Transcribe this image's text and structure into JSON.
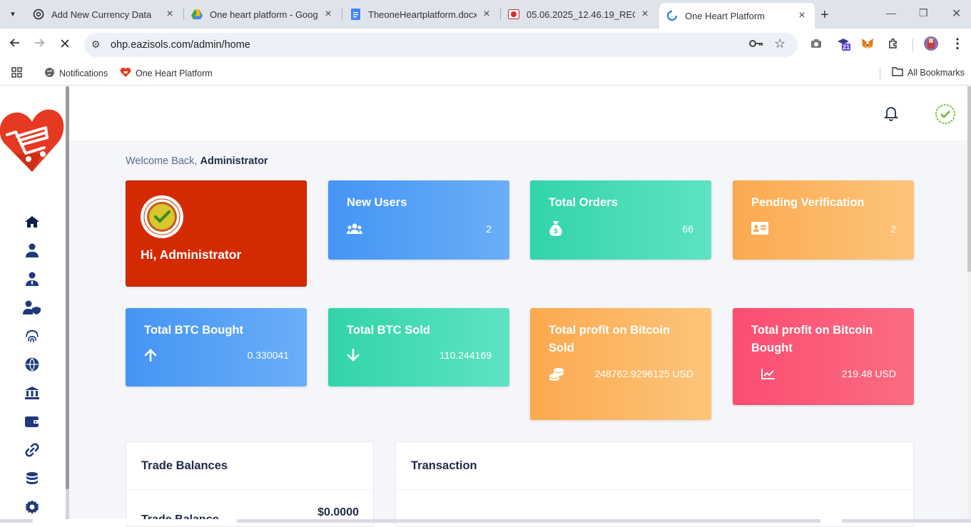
{
  "browser": {
    "tabs": [
      {
        "title": "Add New Currency Data",
        "icon": "openai-icon"
      },
      {
        "title": "One heart platform - Google",
        "icon": "google-drive-icon"
      },
      {
        "title": "TheoneHeartplatform.docx -",
        "icon": "docs-icon"
      },
      {
        "title": "05.06.2025_12.46.19_REC",
        "icon": "recording-icon"
      },
      {
        "title": "One Heart Platform",
        "icon": "loading-spinner-icon"
      }
    ],
    "url": "ohp.eazisols.com/admin/home",
    "extension_badge": "21",
    "bookmarks": [
      {
        "label": "Notifications"
      },
      {
        "label": "One Heart Platform"
      }
    ],
    "all_bookmarks_label": "All Bookmarks"
  },
  "welcome": {
    "prefix": "Welcome Back,",
    "name": "Administrator"
  },
  "hi_card": {
    "text": "Hi, Administrator"
  },
  "stats": [
    {
      "title": "New Users",
      "value": "2",
      "icon": "users-icon"
    },
    {
      "title": "Total Orders",
      "value": "66",
      "icon": "money-bag-icon"
    },
    {
      "title": "Pending Verification",
      "value": "2",
      "icon": "id-card-icon"
    },
    {
      "title": "Total BTC Bought",
      "value": "0.330041",
      "icon": "arrow-up-icon"
    },
    {
      "title": "Total BTC Sold",
      "value": "110.244169",
      "icon": "arrow-down-icon"
    },
    {
      "title": "Total profit on Bitcoin Sold",
      "value": "248762.9296125 USD",
      "icon": "coins-icon"
    },
    {
      "title": "Total profit on Bitcoin Bought",
      "value": "219.48 USD",
      "icon": "chart-line-icon"
    }
  ],
  "panels": {
    "trade_balances": {
      "title": "Trade Balances",
      "row_label": "Trade Balance",
      "row_value": "$0.0000"
    },
    "transaction": {
      "title": "Transaction"
    }
  },
  "colors": {
    "hi_card": "#d42a04",
    "blue": "#4595f5",
    "green": "#32d4a9",
    "orange": "#fba94f",
    "pink": "#fb4d72",
    "heading": "#1f2a44"
  }
}
